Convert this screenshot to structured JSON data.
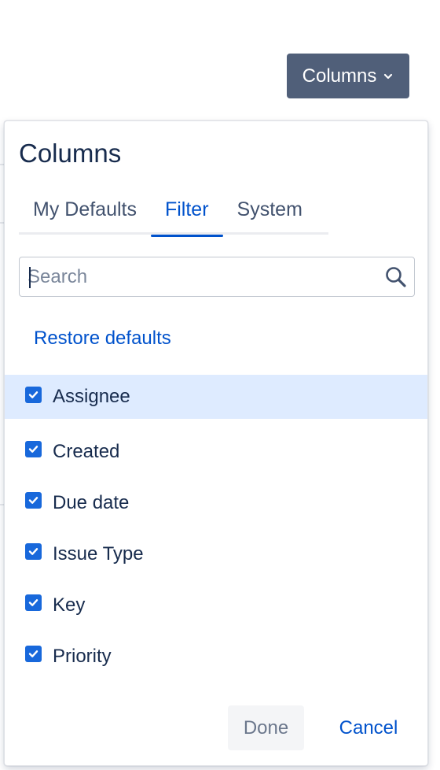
{
  "trigger": {
    "label": "Columns",
    "icon": "chevron-down-icon"
  },
  "dropdown": {
    "title": "Columns",
    "tabs": [
      {
        "label": "My Defaults",
        "active": false
      },
      {
        "label": "Filter",
        "active": true
      },
      {
        "label": "System",
        "active": false
      }
    ],
    "search": {
      "placeholder": "Search",
      "value": ""
    },
    "restore_label": "Restore defaults",
    "items": [
      {
        "label": "Assignee",
        "checked": true,
        "highlighted": true
      },
      {
        "label": "Created",
        "checked": true
      },
      {
        "label": "Due date",
        "checked": true
      },
      {
        "label": "Issue Type",
        "checked": true
      },
      {
        "label": "Key",
        "checked": true
      },
      {
        "label": "Priority",
        "checked": true
      }
    ],
    "done_label": "Done",
    "cancel_label": "Cancel"
  },
  "colors": {
    "trigger_bg": "#505f79",
    "accent": "#0052cc",
    "checkbox": "#1868db",
    "highlight": "#deebff"
  }
}
